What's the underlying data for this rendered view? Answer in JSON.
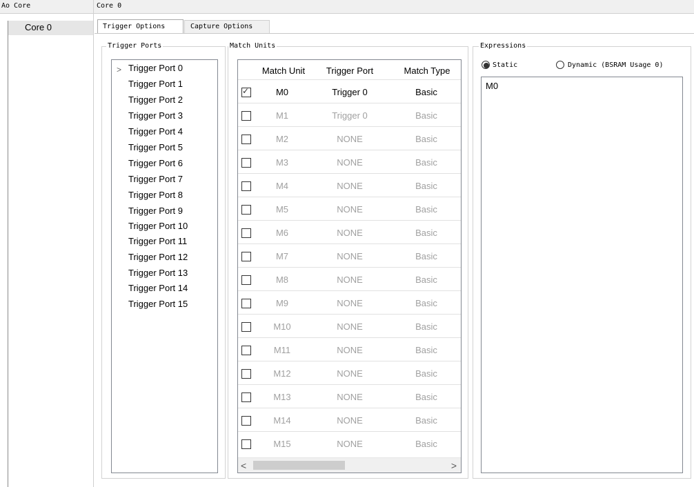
{
  "header": {
    "left_title": "Ao Core",
    "right_title": "Core 0"
  },
  "tree": {
    "items": [
      {
        "label": "Core 0"
      }
    ]
  },
  "tabs": [
    {
      "label": "Trigger Options"
    },
    {
      "label": "Capture Options"
    }
  ],
  "trigger_ports": {
    "title": "Trigger Ports",
    "expand_glyph": ">",
    "items": [
      "Trigger Port 0",
      "Trigger Port 1",
      "Trigger Port 2",
      "Trigger Port 3",
      "Trigger Port 4",
      "Trigger Port 5",
      "Trigger Port 6",
      "Trigger Port 7",
      "Trigger Port 8",
      "Trigger Port 9",
      "Trigger Port 10",
      "Trigger Port 11",
      "Trigger Port 12",
      "Trigger Port 13",
      "Trigger Port 14",
      "Trigger Port 15"
    ]
  },
  "match_units": {
    "title": "Match Units",
    "headers": {
      "unit": "Match Unit",
      "port": "Trigger Port",
      "type": "Match Type"
    },
    "rows": [
      {
        "unit": "M0",
        "port": "Trigger 0",
        "type": "Basic",
        "checked": true
      },
      {
        "unit": "M1",
        "port": "Trigger 0",
        "type": "Basic",
        "checked": false
      },
      {
        "unit": "M2",
        "port": "NONE",
        "type": "Basic",
        "checked": false
      },
      {
        "unit": "M3",
        "port": "NONE",
        "type": "Basic",
        "checked": false
      },
      {
        "unit": "M4",
        "port": "NONE",
        "type": "Basic",
        "checked": false
      },
      {
        "unit": "M5",
        "port": "NONE",
        "type": "Basic",
        "checked": false
      },
      {
        "unit": "M6",
        "port": "NONE",
        "type": "Basic",
        "checked": false
      },
      {
        "unit": "M7",
        "port": "NONE",
        "type": "Basic",
        "checked": false
      },
      {
        "unit": "M8",
        "port": "NONE",
        "type": "Basic",
        "checked": false
      },
      {
        "unit": "M9",
        "port": "NONE",
        "type": "Basic",
        "checked": false
      },
      {
        "unit": "M10",
        "port": "NONE",
        "type": "Basic",
        "checked": false
      },
      {
        "unit": "M11",
        "port": "NONE",
        "type": "Basic",
        "checked": false
      },
      {
        "unit": "M12",
        "port": "NONE",
        "type": "Basic",
        "checked": false
      },
      {
        "unit": "M13",
        "port": "NONE",
        "type": "Basic",
        "checked": false
      },
      {
        "unit": "M14",
        "port": "NONE",
        "type": "Basic",
        "checked": false
      },
      {
        "unit": "M15",
        "port": "NONE",
        "type": "Basic",
        "checked": false
      }
    ],
    "scroll_left_glyph": "<",
    "scroll_right_glyph": ">"
  },
  "expressions": {
    "title": "Expressions",
    "static_label": "Static",
    "dynamic_label": "Dynamic (BSRAM Usage 0)",
    "selected": "static",
    "value": "M0"
  },
  "colors": {
    "checked_text": "#000000",
    "disabled_text": "#a0a0a0",
    "selected_item_bg": "#e6e6e6"
  }
}
